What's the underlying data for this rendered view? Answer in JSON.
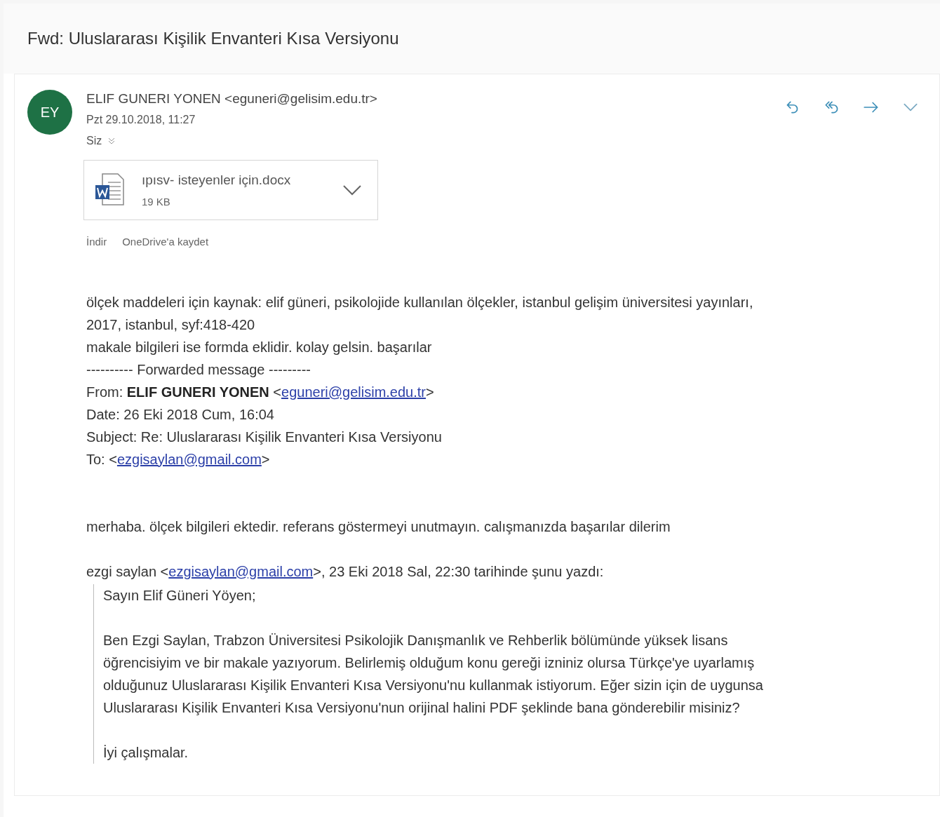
{
  "subject": "Fwd: Uluslararası Kişilik Envanteri Kısa Versiyonu",
  "message": {
    "avatar": {
      "initials": "EY",
      "color": "#1e7145"
    },
    "sender": "ELIF GUNERI YONEN <eguneri@gelisim.edu.tr>",
    "date": "Pzt 29.10.2018, 11:27",
    "recipient": "Siz",
    "actions": [
      {
        "kind": "reply"
      },
      {
        "kind": "reply-all"
      },
      {
        "kind": "forward"
      },
      {
        "kind": "more"
      }
    ],
    "attachment": {
      "name": "ıpısv- isteyenler için.docx",
      "size": "19 KB"
    },
    "attachment_links": [
      "İndir",
      "OneDrive'a kaydet"
    ],
    "body": [
      {
        "kind": "line",
        "parts": [
          {
            "kind": "text",
            "text": "ölçek maddeleri için kaynak: elif güneri, psikolojide kullanılan ölçekler, istanbul gelişim üniversitesi yayınları,"
          }
        ]
      },
      {
        "kind": "line",
        "parts": [
          {
            "kind": "text",
            "text": "2017, istanbul, syf:418-420"
          }
        ]
      },
      {
        "kind": "line",
        "parts": [
          {
            "kind": "text",
            "text": "makale bilgileri ise formda eklidir. kolay gelsin. başarılar"
          }
        ]
      },
      {
        "kind": "line",
        "parts": [
          {
            "kind": "text",
            "text": "---------- Forwarded message ---------"
          }
        ]
      },
      {
        "kind": "line",
        "parts": [
          {
            "kind": "text",
            "text": "From: "
          },
          {
            "kind": "bold",
            "text": "ELIF GUNERI YONEN"
          },
          {
            "kind": "text",
            "text": " <"
          },
          {
            "kind": "link",
            "text": "eguneri@gelisim.edu.tr"
          },
          {
            "kind": "text",
            "text": ">"
          }
        ]
      },
      {
        "kind": "line",
        "parts": [
          {
            "kind": "text",
            "text": "Date: 26 Eki 2018 Cum, 16:04"
          }
        ]
      },
      {
        "kind": "line",
        "parts": [
          {
            "kind": "text",
            "text": "Subject: Re: Uluslararası Kişilik Envanteri Kısa Versiyonu"
          }
        ]
      },
      {
        "kind": "line",
        "parts": [
          {
            "kind": "text",
            "text": "To: <"
          },
          {
            "kind": "link",
            "text": "ezgisaylan@gmail.com"
          },
          {
            "kind": "text",
            "text": ">"
          }
        ]
      },
      {
        "kind": "gap"
      },
      {
        "kind": "gap"
      },
      {
        "kind": "line",
        "parts": [
          {
            "kind": "text",
            "text": "merhaba. ölçek bilgileri ektedir. referans göstermeyi unutmayın. calışmanızda başarılar dilerim"
          }
        ]
      },
      {
        "kind": "gap"
      },
      {
        "kind": "line",
        "parts": [
          {
            "kind": "text",
            "text": "ezgi saylan <"
          },
          {
            "kind": "link",
            "text": "ezgisaylan@gmail.com"
          },
          {
            "kind": "text",
            "text": ">, 23 Eki 2018 Sal, 22:30 tarihinde şunu yazdı:"
          }
        ]
      }
    ],
    "quote": [
      {
        "kind": "line",
        "text": "Sayın Elif Güneri Yöyen;"
      },
      {
        "kind": "gap"
      },
      {
        "kind": "line",
        "text": "Ben Ezgi Saylan, Trabzon Üniversitesi Psikolojik Danışmanlık ve Rehberlik bölümünde yüksek lisans"
      },
      {
        "kind": "line",
        "text": "öğrencisiyim ve bir makale yazıyorum. Belirlemiş olduğum konu gereği izniniz olursa Türkçe'ye uyarlamış"
      },
      {
        "kind": "line",
        "text": "olduğunuz Uluslararası Kişilik Envanteri Kısa Versiyonu'nu kullanmak istiyorum. Eğer sizin için de uygunsa"
      },
      {
        "kind": "line",
        "text": "Uluslararası Kişilik Envanteri Kısa Versiyonu'nun orijinal halini PDF şeklinde bana gönderebilir misiniz?"
      },
      {
        "kind": "gap"
      },
      {
        "kind": "line",
        "text": "İyi çalışmalar."
      }
    ]
  }
}
